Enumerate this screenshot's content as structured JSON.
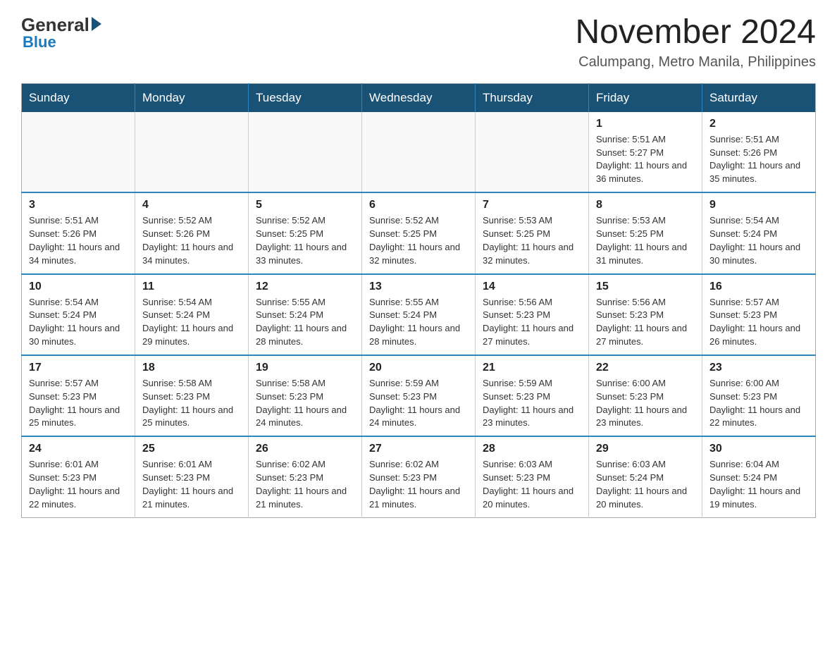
{
  "header": {
    "logo": {
      "general": "General",
      "arrow": "",
      "blue": "Blue"
    },
    "month_title": "November 2024",
    "location": "Calumpang, Metro Manila, Philippines"
  },
  "calendar": {
    "days_of_week": [
      "Sunday",
      "Monday",
      "Tuesday",
      "Wednesday",
      "Thursday",
      "Friday",
      "Saturday"
    ],
    "weeks": [
      [
        {
          "day": "",
          "info": ""
        },
        {
          "day": "",
          "info": ""
        },
        {
          "day": "",
          "info": ""
        },
        {
          "day": "",
          "info": ""
        },
        {
          "day": "",
          "info": ""
        },
        {
          "day": "1",
          "info": "Sunrise: 5:51 AM\nSunset: 5:27 PM\nDaylight: 11 hours and 36 minutes."
        },
        {
          "day": "2",
          "info": "Sunrise: 5:51 AM\nSunset: 5:26 PM\nDaylight: 11 hours and 35 minutes."
        }
      ],
      [
        {
          "day": "3",
          "info": "Sunrise: 5:51 AM\nSunset: 5:26 PM\nDaylight: 11 hours and 34 minutes."
        },
        {
          "day": "4",
          "info": "Sunrise: 5:52 AM\nSunset: 5:26 PM\nDaylight: 11 hours and 34 minutes."
        },
        {
          "day": "5",
          "info": "Sunrise: 5:52 AM\nSunset: 5:25 PM\nDaylight: 11 hours and 33 minutes."
        },
        {
          "day": "6",
          "info": "Sunrise: 5:52 AM\nSunset: 5:25 PM\nDaylight: 11 hours and 32 minutes."
        },
        {
          "day": "7",
          "info": "Sunrise: 5:53 AM\nSunset: 5:25 PM\nDaylight: 11 hours and 32 minutes."
        },
        {
          "day": "8",
          "info": "Sunrise: 5:53 AM\nSunset: 5:25 PM\nDaylight: 11 hours and 31 minutes."
        },
        {
          "day": "9",
          "info": "Sunrise: 5:54 AM\nSunset: 5:24 PM\nDaylight: 11 hours and 30 minutes."
        }
      ],
      [
        {
          "day": "10",
          "info": "Sunrise: 5:54 AM\nSunset: 5:24 PM\nDaylight: 11 hours and 30 minutes."
        },
        {
          "day": "11",
          "info": "Sunrise: 5:54 AM\nSunset: 5:24 PM\nDaylight: 11 hours and 29 minutes."
        },
        {
          "day": "12",
          "info": "Sunrise: 5:55 AM\nSunset: 5:24 PM\nDaylight: 11 hours and 28 minutes."
        },
        {
          "day": "13",
          "info": "Sunrise: 5:55 AM\nSunset: 5:24 PM\nDaylight: 11 hours and 28 minutes."
        },
        {
          "day": "14",
          "info": "Sunrise: 5:56 AM\nSunset: 5:23 PM\nDaylight: 11 hours and 27 minutes."
        },
        {
          "day": "15",
          "info": "Sunrise: 5:56 AM\nSunset: 5:23 PM\nDaylight: 11 hours and 27 minutes."
        },
        {
          "day": "16",
          "info": "Sunrise: 5:57 AM\nSunset: 5:23 PM\nDaylight: 11 hours and 26 minutes."
        }
      ],
      [
        {
          "day": "17",
          "info": "Sunrise: 5:57 AM\nSunset: 5:23 PM\nDaylight: 11 hours and 25 minutes."
        },
        {
          "day": "18",
          "info": "Sunrise: 5:58 AM\nSunset: 5:23 PM\nDaylight: 11 hours and 25 minutes."
        },
        {
          "day": "19",
          "info": "Sunrise: 5:58 AM\nSunset: 5:23 PM\nDaylight: 11 hours and 24 minutes."
        },
        {
          "day": "20",
          "info": "Sunrise: 5:59 AM\nSunset: 5:23 PM\nDaylight: 11 hours and 24 minutes."
        },
        {
          "day": "21",
          "info": "Sunrise: 5:59 AM\nSunset: 5:23 PM\nDaylight: 11 hours and 23 minutes."
        },
        {
          "day": "22",
          "info": "Sunrise: 6:00 AM\nSunset: 5:23 PM\nDaylight: 11 hours and 23 minutes."
        },
        {
          "day": "23",
          "info": "Sunrise: 6:00 AM\nSunset: 5:23 PM\nDaylight: 11 hours and 22 minutes."
        }
      ],
      [
        {
          "day": "24",
          "info": "Sunrise: 6:01 AM\nSunset: 5:23 PM\nDaylight: 11 hours and 22 minutes."
        },
        {
          "day": "25",
          "info": "Sunrise: 6:01 AM\nSunset: 5:23 PM\nDaylight: 11 hours and 21 minutes."
        },
        {
          "day": "26",
          "info": "Sunrise: 6:02 AM\nSunset: 5:23 PM\nDaylight: 11 hours and 21 minutes."
        },
        {
          "day": "27",
          "info": "Sunrise: 6:02 AM\nSunset: 5:23 PM\nDaylight: 11 hours and 21 minutes."
        },
        {
          "day": "28",
          "info": "Sunrise: 6:03 AM\nSunset: 5:23 PM\nDaylight: 11 hours and 20 minutes."
        },
        {
          "day": "29",
          "info": "Sunrise: 6:03 AM\nSunset: 5:24 PM\nDaylight: 11 hours and 20 minutes."
        },
        {
          "day": "30",
          "info": "Sunrise: 6:04 AM\nSunset: 5:24 PM\nDaylight: 11 hours and 19 minutes."
        }
      ]
    ]
  }
}
